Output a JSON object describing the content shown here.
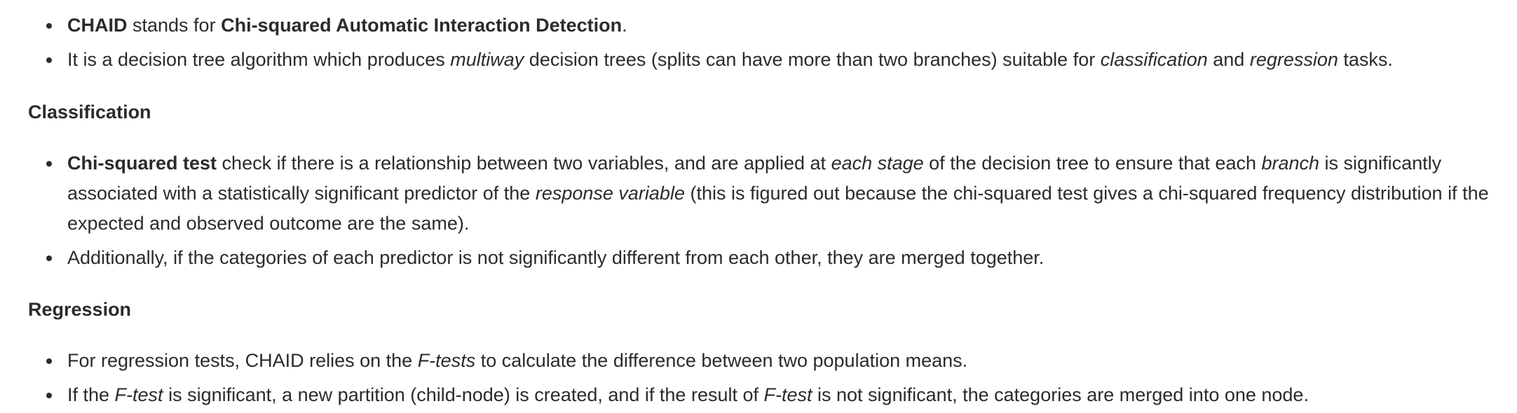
{
  "intro": {
    "items": [
      {
        "s1": "CHAID",
        "s2": " stands for ",
        "s3": "Chi-squared Automatic Interaction Detection",
        "s4": "."
      },
      {
        "s1": "It is a decision tree algorithm which produces ",
        "s2": "multiway",
        "s3": " decision trees (splits can have more than two branches) suitable for ",
        "s4": "classification",
        "s5": " and ",
        "s6": "regression",
        "s7": " tasks."
      }
    ]
  },
  "classification": {
    "heading": "Classification",
    "items": [
      {
        "s1": "Chi-squared test",
        "s2": " check if there is a relationship between two variables, and are applied at ",
        "s3": "each stage",
        "s4": " of the decision tree to ensure that each ",
        "s5": "branch",
        "s6": " is significantly associated with a statistically significant predictor of the ",
        "s7": "response variable",
        "s8": " (this is figured out because the chi-squared test gives a chi-squared frequency distribution if the expected and observed outcome are the same)."
      },
      {
        "s1": "Additionally, if the categories of each predictor is not significantly different from each other, they are merged together."
      }
    ]
  },
  "regression": {
    "heading": "Regression",
    "items": [
      {
        "s1": "For regression tests, CHAID relies on the ",
        "s2": "F-tests",
        "s3": " to calculate the difference between two population means."
      },
      {
        "s1": "If the ",
        "s2": "F-test",
        "s3": " is significant, a new partition (child-node) is created, and if the result of ",
        "s4": "F-test",
        "s5": " is not significant, the categories are merged into one node."
      }
    ]
  }
}
